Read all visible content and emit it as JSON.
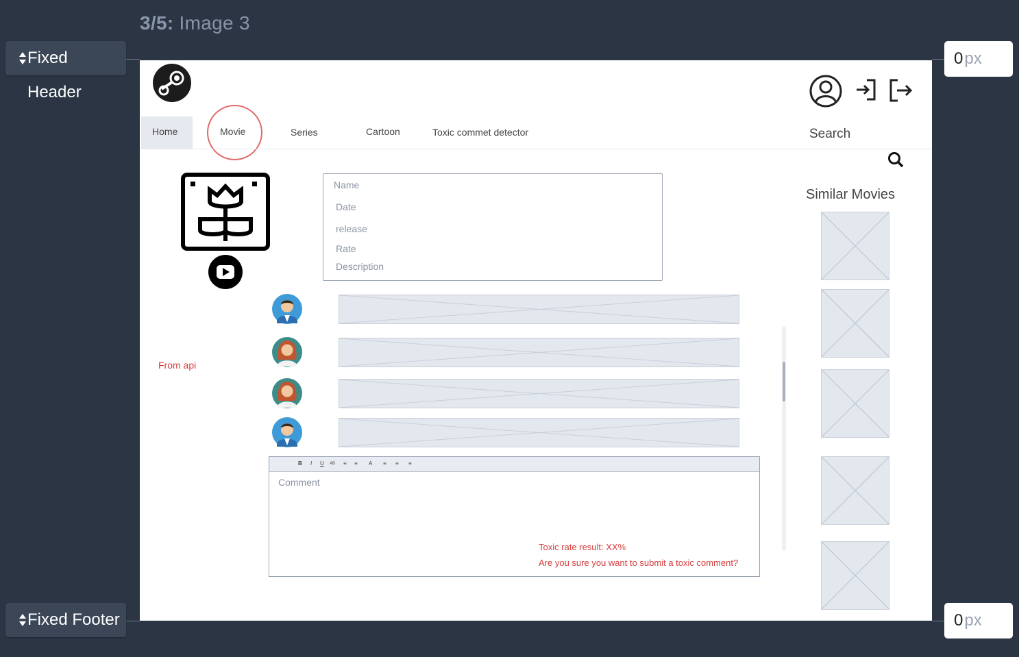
{
  "frame": {
    "counter": "3/5:",
    "title": "Image 3"
  },
  "controls": {
    "header_label": "Fixed Header",
    "footer_label": "Fixed Footer",
    "header_value": "0",
    "footer_value": "0",
    "unit": "px"
  },
  "nav": {
    "items": [
      "Home",
      "Movie",
      "Series",
      "Cartoon",
      "Toxic commet detector"
    ],
    "search_label": "Search"
  },
  "movie_info": {
    "fields": [
      "Name",
      "Date",
      "release",
      "Rate",
      "Description"
    ]
  },
  "comments_section": {
    "source_note": "From api",
    "comment_placeholder": "Comment",
    "toxic_result": "Toxic rate result:  XX%",
    "toxic_confirm": "Are you sure you want to submit a toxic comment?",
    "toolbar_tools": [
      "B",
      "I",
      "U",
      "AB",
      "bullet-list",
      "numbered-list",
      "font-color",
      "align-left",
      "align-center",
      "align-right"
    ]
  },
  "sidebar": {
    "title": "Similar Movies"
  },
  "icons": [
    "steam-logo-icon",
    "user-account-icon",
    "login-icon",
    "logout-icon",
    "search-icon",
    "movie-poster-icon",
    "play-icon"
  ],
  "colors": {
    "background": "#2b3544",
    "accent_red": "#d43b3b",
    "placeholder": "#e3e7ee"
  }
}
